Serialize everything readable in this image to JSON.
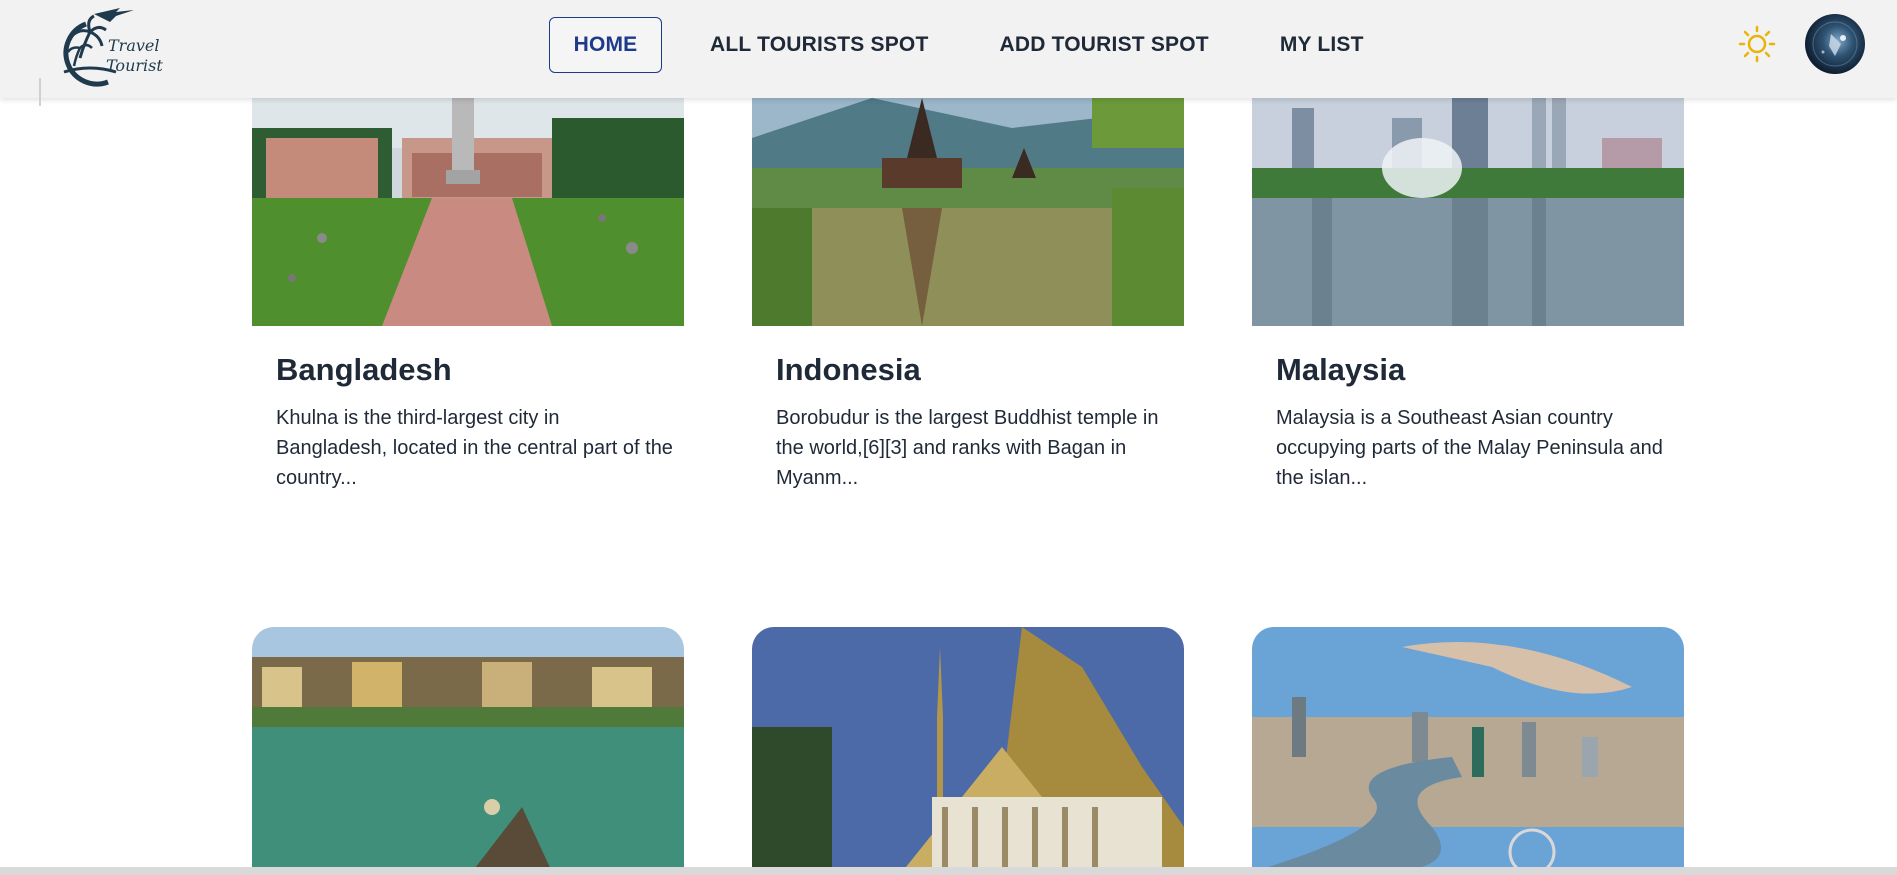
{
  "brand": {
    "logo_line1": "Travel",
    "logo_line2": "Tourist",
    "logo_icon": "palm-plane-logo"
  },
  "nav": {
    "home": "HOME",
    "all_spots": "ALL TOURISTS SPOT",
    "add_spot": "ADD TOURIST SPOT",
    "my_list": "MY LIST",
    "active": "HOME",
    "accent_color": "#1e3a8a"
  },
  "header_actions": {
    "theme_icon": "sun-icon",
    "theme_color": "#eab308",
    "avatar_icon": "user-avatar"
  },
  "cards": [
    {
      "title": "Bangladesh",
      "description": "Khulna is the third-largest city in Bangladesh, located in the central part of the country...",
      "image": "university-campus-statue"
    },
    {
      "title": "Indonesia",
      "description": "Borobudur is the largest Buddhist temple in the world,[6][3] and ranks with Bagan in Myanm...",
      "image": "lake-temple-pagoda"
    },
    {
      "title": "Malaysia",
      "description": "Malaysia is a Southeast Asian country occupying parts of the Malay Peninsula and the islan...",
      "image": "city-skyline-fountain"
    },
    {
      "title": "",
      "description": "",
      "image": "riverside-old-town-boat"
    },
    {
      "title": "",
      "description": "",
      "image": "golden-royal-palace"
    },
    {
      "title": "",
      "description": "",
      "image": "river-city-skyline"
    }
  ]
}
